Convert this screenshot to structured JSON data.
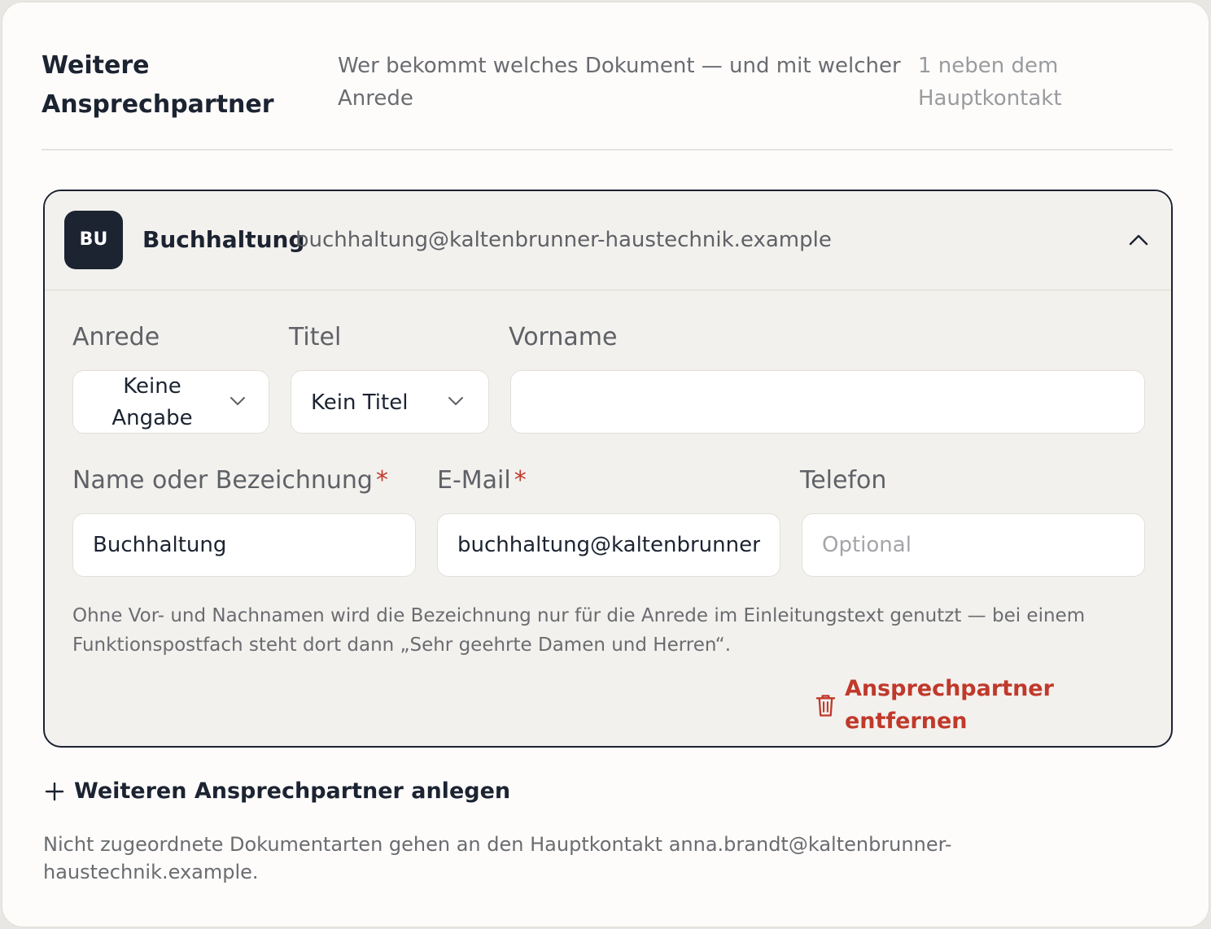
{
  "section": {
    "title": "Weitere Ansprechpartner",
    "description": "Wer bekommt welches Dokument — und mit welcher Anrede",
    "count": "1 neben dem Hauptkontakt"
  },
  "contact": {
    "avatar": "BU",
    "name": "Buchhaltung",
    "email": "buchhaltung@kaltenbrunner-haustechnik.example",
    "collapse_icon": "chevron-up-icon",
    "fields": {
      "anrede_label": "Anrede",
      "anrede_value": "Keine Angabe",
      "titel_label": "Titel",
      "titel_value": "Kein Titel",
      "vorname_label": "Vorname",
      "vorname_value": "",
      "name_label": "Name oder Bezeichnung",
      "name_value": "Buchhaltung",
      "email_label": "E-Mail",
      "email_value": "buchhaltung@kaltenbrunner-haustechnik.example",
      "telefon_label": "Telefon",
      "telefon_placeholder": "Optional",
      "required_marker": "*"
    },
    "hint": "Ohne Vor- und Nachnamen wird die Bezeichnung nur für die Anrede im Einleitungstext genutzt — bei einem Funktionspostfach steht dort dann „Sehr geehrte Damen und Herren“.",
    "remove_label": "Ansprechpartner entfernen",
    "remove_icon": "trash-icon"
  },
  "add_label": "Weiteren Ansprechpartner anlegen",
  "add_icon": "plus-icon",
  "footer_note": "Nicht zugeordnete Dokumentarten gehen an den Hauptkontakt anna.brandt@kaltenbrunner-haustechnik.example.",
  "colors": {
    "accent_dark": "#1c2331",
    "danger": "#c0392b",
    "panel": "#f3f1ee"
  }
}
